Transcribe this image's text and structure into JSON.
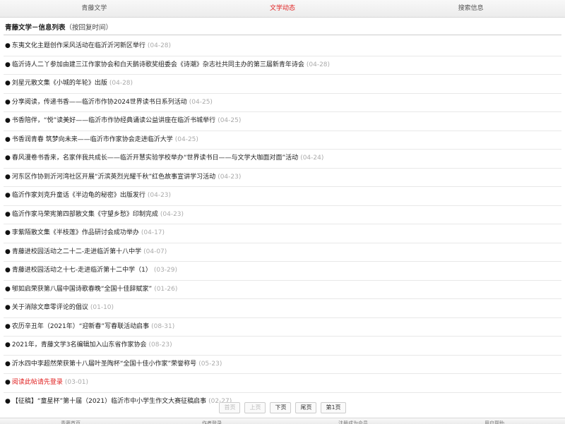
{
  "topnav": {
    "tabs": [
      {
        "label": "青藤文学",
        "active": false
      },
      {
        "label": "文学动态",
        "active": true
      },
      {
        "label": "搜索信息",
        "active": false
      }
    ]
  },
  "heading": {
    "title": "青藤文学－信息列表",
    "subtitle": "（按回复时间）"
  },
  "items": [
    {
      "title": "东夷文化主题创作采风活动在临沂沂河新区举行",
      "date": "(04-28)"
    },
    {
      "title": "临沂诗人二丫参加由建三江作家协会和白天鹅诗歌奖组委会《诗潮》杂志社共同主办的第三届新青年诗会",
      "date": "(04-28)"
    },
    {
      "title": "刘星元散文集《小城的年轮》出版",
      "date": "(04-28)"
    },
    {
      "title": "分享阅读，传递书香——临沂市作协2024世界读书日系列活动",
      "date": "(04-25)"
    },
    {
      "title": "书香陪伴，“悦”读美好——临沂市作协经典诵读公益讲座在临沂书城举行",
      "date": "(04-25)"
    },
    {
      "title": "书香润青春 筑梦向未来——临沂市作家协会走进临沂大学",
      "date": "(04-25)"
    },
    {
      "title": "春风漫卷书香来，名家伴我共成长——临沂开慧实验学校举办“世界读书日——与文学大咖面对面”活动",
      "date": "(04-24)"
    },
    {
      "title": "河东区作协到沂河湾社区开展“沂滨英烈光耀千秋”红色故事宣讲学习活动",
      "date": "(04-23)"
    },
    {
      "title": "临沂作家刘克升童话《半边龟的秘密》出版发行",
      "date": "(04-23)"
    },
    {
      "title": "临沂作家马荣宪第四部散文集《守望乡愁》印制完成",
      "date": "(04-23)"
    },
    {
      "title": "李紫陌散文集《半枝莲》作品研讨会成功举办",
      "date": "(04-17)"
    },
    {
      "title": "青藤进校园活动之二十二-走进临沂第十八中学",
      "date": "(04-07)"
    },
    {
      "title": "青藤进校园活动之十七-走进临沂第十二中学（1）",
      "date": "(03-29)"
    },
    {
      "title": "郇如启荣获第八届中国诗歌春晚“全国十佳辞赋家”",
      "date": "(01-26)"
    },
    {
      "title": "关于消除文章零评论的倡议",
      "date": "(01-10)"
    },
    {
      "title": "农历辛丑年（2021年）“迎新春”写春联活动启事",
      "date": "(08-31)"
    },
    {
      "title": "2021年，青藤文学3名编辑加入山东省作家协会",
      "date": "(08-23)"
    },
    {
      "title": "沂水四中李超然荣获第十八届叶圣陶杯“全国十佳小作家”荣誉称号",
      "date": "(05-23)"
    },
    {
      "title": "阅读此帖请先登录",
      "date": "(03-01)",
      "red": true
    },
    {
      "title": "【征稿】“童星杯”第十届（2021）临沂市中小学生作文大赛征稿启事",
      "date": "(02-27)"
    }
  ],
  "bullet": "●",
  "pager": {
    "first": "首页",
    "prev": "上页",
    "next": "下页",
    "last": "尾页",
    "current": "第1页"
  },
  "footer": {
    "items": [
      "青藤首页",
      "作者登录",
      "注册成为会员",
      "用户帮助"
    ]
  }
}
